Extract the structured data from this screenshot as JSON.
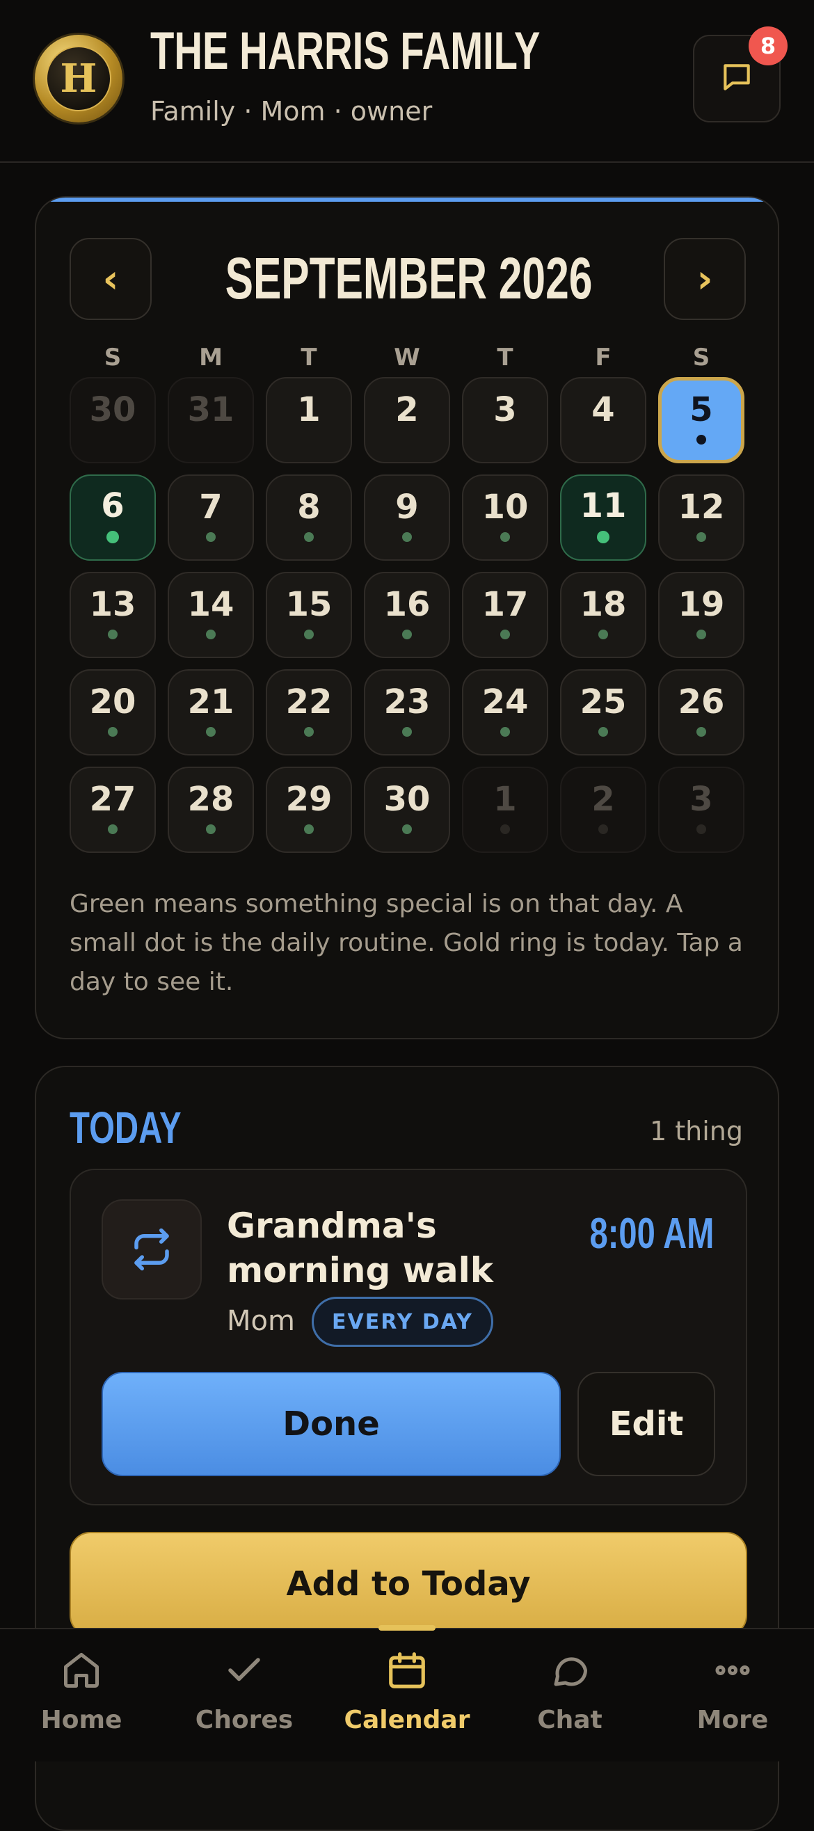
{
  "header": {
    "logo_letter": "H",
    "family_name": "THE HARRIS FAMILY",
    "subtitle": "Family · Mom · owner",
    "messages_icon": "chat-bubble-icon",
    "unread_count": "8"
  },
  "calendar": {
    "prev_label": "‹",
    "next_label": "›",
    "month_title": "SEPTEMBER 2026",
    "weekdays": [
      "S",
      "M",
      "T",
      "W",
      "T",
      "F",
      "S"
    ],
    "days": [
      {
        "n": "30",
        "state": "muted",
        "dot": false
      },
      {
        "n": "31",
        "state": "muted",
        "dot": false
      },
      {
        "n": "1",
        "state": "normal",
        "dot": false
      },
      {
        "n": "2",
        "state": "normal",
        "dot": false
      },
      {
        "n": "3",
        "state": "normal",
        "dot": false
      },
      {
        "n": "4",
        "state": "normal",
        "dot": false
      },
      {
        "n": "5",
        "state": "today",
        "dot": true
      },
      {
        "n": "6",
        "state": "special",
        "dot": true
      },
      {
        "n": "7",
        "state": "normal",
        "dot": true
      },
      {
        "n": "8",
        "state": "normal",
        "dot": true
      },
      {
        "n": "9",
        "state": "normal",
        "dot": true
      },
      {
        "n": "10",
        "state": "normal",
        "dot": true
      },
      {
        "n": "11",
        "state": "special",
        "dot": true
      },
      {
        "n": "12",
        "state": "normal",
        "dot": true
      },
      {
        "n": "13",
        "state": "normal",
        "dot": true
      },
      {
        "n": "14",
        "state": "normal",
        "dot": true
      },
      {
        "n": "15",
        "state": "normal",
        "dot": true
      },
      {
        "n": "16",
        "state": "normal",
        "dot": true
      },
      {
        "n": "17",
        "state": "normal",
        "dot": true
      },
      {
        "n": "18",
        "state": "normal",
        "dot": true
      },
      {
        "n": "19",
        "state": "normal",
        "dot": true
      },
      {
        "n": "20",
        "state": "normal",
        "dot": true
      },
      {
        "n": "21",
        "state": "normal",
        "dot": true
      },
      {
        "n": "22",
        "state": "normal",
        "dot": true
      },
      {
        "n": "23",
        "state": "normal",
        "dot": true
      },
      {
        "n": "24",
        "state": "normal",
        "dot": true
      },
      {
        "n": "25",
        "state": "normal",
        "dot": true
      },
      {
        "n": "26",
        "state": "normal",
        "dot": true
      },
      {
        "n": "27",
        "state": "normal",
        "dot": true
      },
      {
        "n": "28",
        "state": "normal",
        "dot": true
      },
      {
        "n": "29",
        "state": "normal",
        "dot": true
      },
      {
        "n": "30",
        "state": "normal",
        "dot": true
      },
      {
        "n": "1",
        "state": "muted",
        "dot": true
      },
      {
        "n": "2",
        "state": "muted",
        "dot": true
      },
      {
        "n": "3",
        "state": "muted",
        "dot": true
      }
    ],
    "legend": "Green means something special is on that day. A small dot is the daily routine. Gold ring is today. Tap a day to see it."
  },
  "today": {
    "title": "TODAY",
    "count": "1 thing",
    "task": {
      "icon": "repeat-icon",
      "title": "Grandma's morning walk",
      "time": "8:00 AM",
      "owner": "Mom",
      "badge": "EVERY DAY",
      "done_label": "Done",
      "edit_label": "Edit"
    },
    "add_label": "Add to Today"
  },
  "tabs": [
    {
      "label": "Home",
      "icon": "home-icon",
      "active": false
    },
    {
      "label": "Chores",
      "icon": "check-icon",
      "active": false
    },
    {
      "label": "Calendar",
      "icon": "calendar-icon",
      "active": true
    },
    {
      "label": "Chat",
      "icon": "chat-icon",
      "active": false
    },
    {
      "label": "More",
      "icon": "more-icon",
      "active": false
    }
  ],
  "colors": {
    "accent_blue": "#5c9df0",
    "accent_gold": "#e6c25a",
    "special_green": "#45c07a",
    "badge_red": "#f0574f"
  }
}
